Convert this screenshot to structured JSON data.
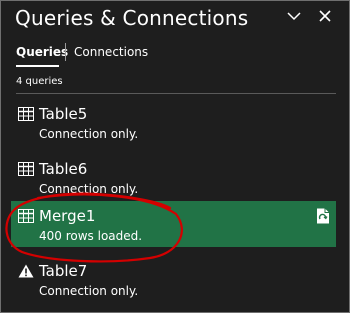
{
  "pane": {
    "title": "Queries & Connections"
  },
  "tabs": [
    {
      "label": "Queries",
      "active": true
    },
    {
      "label": "Connections",
      "active": false
    }
  ],
  "query_count": "4 queries",
  "queries": [
    {
      "name": "Table5",
      "status": "Connection only.",
      "icon": "table-icon",
      "selected": false
    },
    {
      "name": "Table6",
      "status": "Connection only.",
      "icon": "table-icon",
      "selected": false
    },
    {
      "name": "Merge1",
      "status": "400 rows loaded.",
      "icon": "table-icon",
      "selected": true,
      "action_icon": "refresh-icon"
    },
    {
      "name": "Table7",
      "status": "Connection only.",
      "icon": "warning-icon",
      "selected": false
    }
  ],
  "colors": {
    "background": "#1e1e1e",
    "selected": "#217346",
    "annotation": "#d40000"
  }
}
